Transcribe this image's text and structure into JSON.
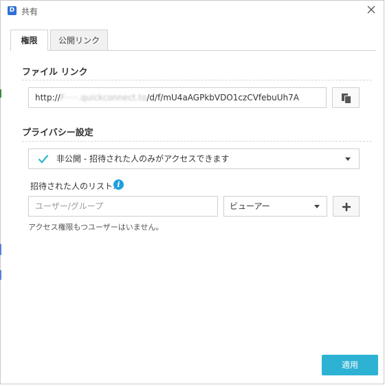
{
  "window": {
    "title": "共有",
    "logo_text": "D"
  },
  "tabs": [
    {
      "label": "権限",
      "active": true
    },
    {
      "label": "公開リンク",
      "active": false
    }
  ],
  "file_link": {
    "section_title": "ファイル リンク",
    "url_prefix": "http://",
    "url_hidden": "F·····.quickconnect.to",
    "url_suffix": "/d/f/mU4aAGPkbVDO1czCVfebuUh7A"
  },
  "privacy": {
    "section_title": "プライバシー設定",
    "selected": "非公開 - 招待された人のみがアクセスできます"
  },
  "invitees": {
    "label": "招待された人のリスト:",
    "user_placeholder": "ユーザー/グループ",
    "role_selected": "ビューアー",
    "empty_message": "アクセス権限もつユーザーはいません。"
  },
  "footer": {
    "apply_label": "適用"
  },
  "colors": {
    "accent": "#2db2d4",
    "info": "#1e9fe0",
    "check": "#2bb5c8",
    "logo": "#2f6fd6"
  },
  "icons": {
    "close": "close-icon",
    "copy": "copy-icon",
    "check": "check-icon",
    "info": "info-icon",
    "add": "plus-icon"
  }
}
